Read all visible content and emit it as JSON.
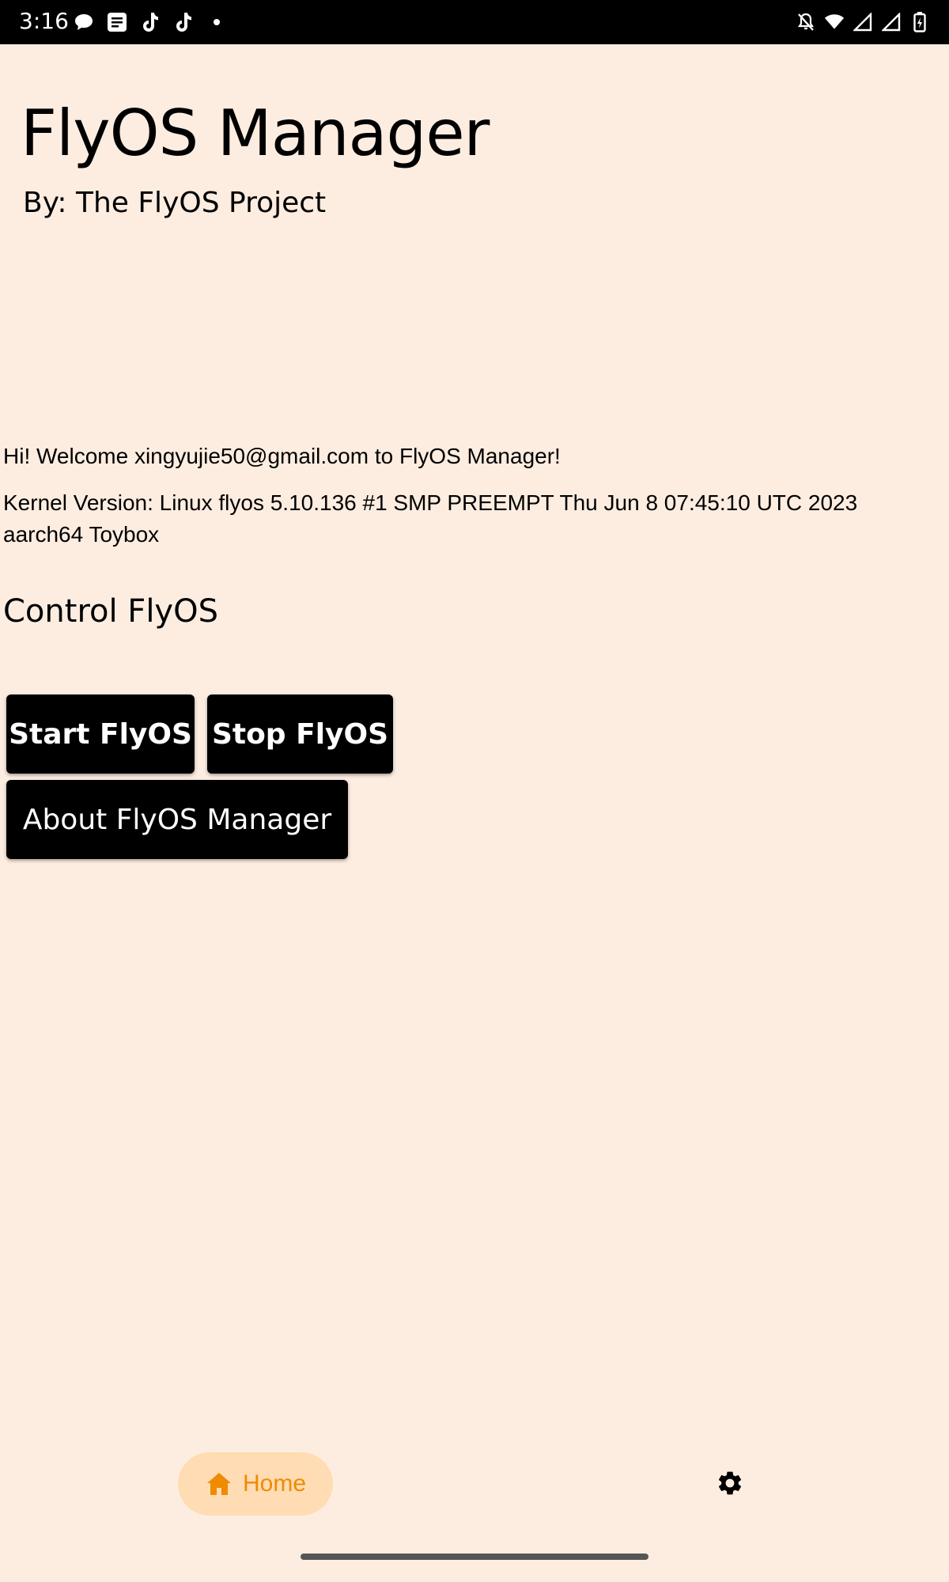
{
  "status_bar": {
    "time": "3:16",
    "left_icons": [
      "chat-bubble-icon",
      "news-icon",
      "tiktok-icon",
      "tiktok-icon",
      "dot-icon"
    ],
    "right_icons": [
      "mute-icon",
      "wifi-icon",
      "signal-icon",
      "signal-icon",
      "battery-icon"
    ]
  },
  "header": {
    "title": "FlyOS Manager",
    "subtitle": "By: The FlyOS Project"
  },
  "main": {
    "welcome": "Hi! Welcome xingyujie50@gmail.com to FlyOS Manager!",
    "kernel": "Kernel Version: Linux flyos 5.10.136 #1 SMP PREEMPT Thu Jun 8 07:45:10 UTC 2023 aarch64 Toybox",
    "section_title": "Control FlyOS",
    "buttons": {
      "start": "Start FlyOS",
      "stop": "Stop FlyOS",
      "about": "About FlyOS Manager"
    }
  },
  "bottom_nav": {
    "home_label": "Home",
    "home_icon": "home-icon",
    "settings_icon": "gear-icon",
    "active_color": "#f08a00",
    "active_bg": "#ffdcb3"
  },
  "colors": {
    "background": "#fdede1",
    "button_bg": "#000000",
    "button_text": "#ffffff"
  }
}
